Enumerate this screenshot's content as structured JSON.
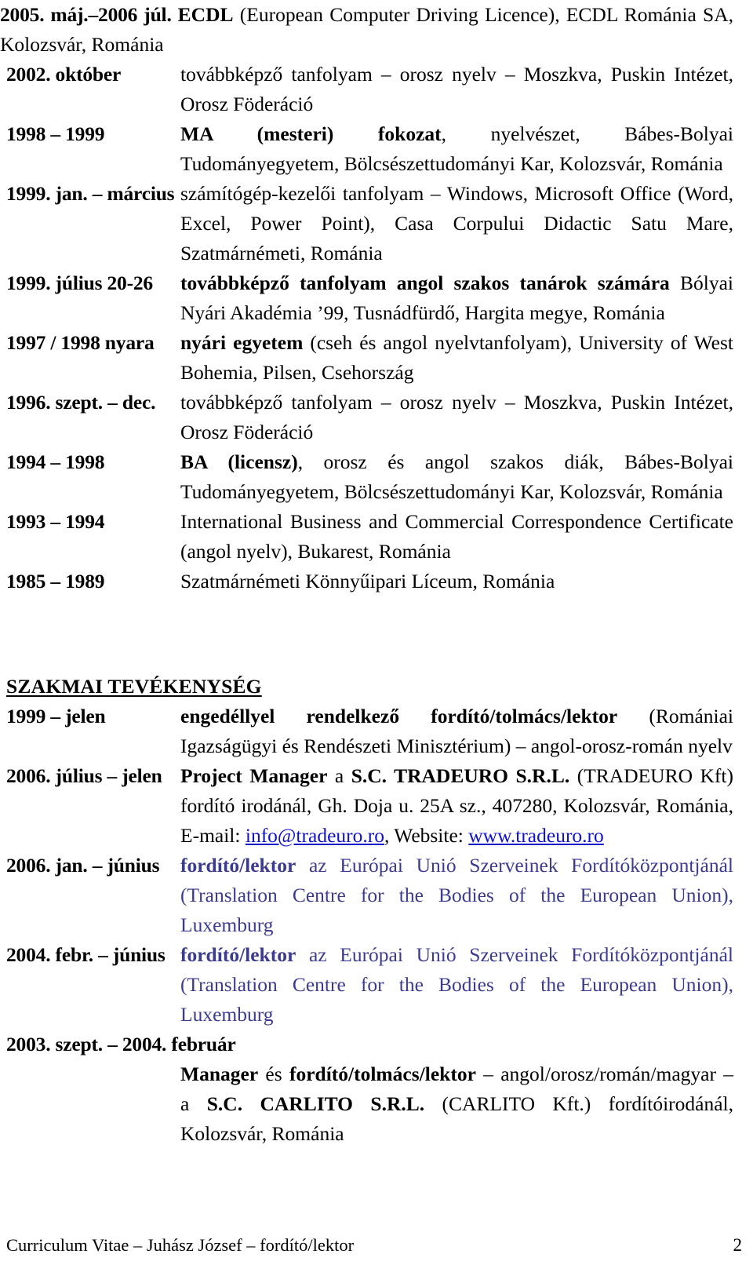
{
  "document": {
    "type": "curriculum-vitae",
    "language": "hu",
    "page_number": "2",
    "footer_text": "Curriculum Vitae – Juhász József – fordító/lektor",
    "link_color": "#1111cc",
    "eu_text_color": "#3b3b8f"
  },
  "education": {
    "entries": [
      {
        "label": "2005. máj.–2006 júl.",
        "inline": true,
        "segments": [
          {
            "text": "ECDL",
            "style": "bold"
          },
          {
            "text": " (European Computer Driving Licence), ECDL Románia SA, Kolozsvár, Románia",
            "style": "normal"
          }
        ]
      },
      {
        "label": "2002. október",
        "inline": false,
        "segments": [
          {
            "text": "továbbképző tanfolyam – orosz nyelv – Moszkva, Puskin Intézet, Orosz Föderáció",
            "style": "normal"
          }
        ]
      },
      {
        "label": "1998 – 1999",
        "inline": false,
        "segments": [
          {
            "text": "MA (mesteri) fokozat",
            "style": "bold"
          },
          {
            "text": ", nyelvészet, Bábes-Bolyai Tudományegyetem, Bölcsészettudományi Kar, Kolozsvár, Románia",
            "style": "normal"
          }
        ]
      },
      {
        "label": "1999. jan. – március",
        "inline": false,
        "segments": [
          {
            "text": "számítógép-kezelői tanfolyam – Windows, Microsoft Office (Word, Excel, Power Point), Casa Corpului Didactic Satu Mare, Szatmárnémeti, Románia",
            "style": "normal"
          }
        ]
      },
      {
        "label": "1999. július 20-26",
        "inline": false,
        "segments": [
          {
            "text": "továbbképző tanfolyam angol szakos tanárok számára",
            "style": "bold"
          },
          {
            "text": " Bólyai Nyári Akadémia ’99, Tusnádfürdő, Hargita megye, Románia",
            "style": "normal"
          }
        ]
      },
      {
        "label": "1997 / 1998 nyara",
        "inline": false,
        "segments": [
          {
            "text": "nyári egyetem",
            "style": "bold"
          },
          {
            "text": " (cseh és angol nyelvtanfolyam), University of West Bohemia, Pilsen, Csehország",
            "style": "normal"
          }
        ]
      },
      {
        "label": "1996. szept. – dec.",
        "inline": false,
        "segments": [
          {
            "text": "továbbképző tanfolyam – orosz nyelv – Moszkva, Puskin Intézet, Orosz Föderáció",
            "style": "normal"
          }
        ]
      },
      {
        "label": "1994 – 1998",
        "inline": false,
        "segments": [
          {
            "text": "BA (licensz)",
            "style": "bold"
          },
          {
            "text": ", orosz és angol szakos diák, Bábes-Bolyai Tudományegyetem, Bölcsészettudományi Kar, Kolozsvár, Románia",
            "style": "normal"
          }
        ]
      },
      {
        "label": "1993 – 1994",
        "inline": false,
        "segments": [
          {
            "text": "International Business and Commercial Correspondence Certificate (angol nyelv), Bukarest, Románia",
            "style": "normal"
          }
        ]
      },
      {
        "label": "1985 – 1989",
        "inline": false,
        "segments": [
          {
            "text": "Szatmárnémeti Könnyűipari Líceum, Románia",
            "style": "normal"
          }
        ]
      }
    ]
  },
  "experience": {
    "heading": "SZAKMAI  TEVÉKENYSÉG",
    "entries": [
      {
        "label": "1999 – jelen",
        "segments": [
          {
            "text": "engedéllyel rendelkező fordító/tolmács/lektor",
            "style": "bold"
          },
          {
            "text": " (Romániai Igazságügyi és Rendészeti Minisztérium) – angol-orosz-román nyelv",
            "style": "normal"
          }
        ]
      },
      {
        "label": "2006. július – jelen",
        "segments": [
          {
            "text": "Project Manager",
            "style": "bold"
          },
          {
            "text": " a ",
            "style": "normal"
          },
          {
            "text": "S.C. TRADEURO S.R.L.",
            "style": "bold"
          },
          {
            "text": " (TRADEURO Kft) fordító irodánál, Gh. Doja u. 25A sz., 407280, Kolozsvár, Románia, E-mail: ",
            "style": "normal"
          },
          {
            "text": "info@tradeuro.ro",
            "style": "link"
          },
          {
            "text": ", Website: ",
            "style": "normal"
          },
          {
            "text": "www.tradeuro.ro",
            "style": "link"
          }
        ]
      },
      {
        "label": "2006. jan. – június",
        "segments": [
          {
            "text": "fordító/lektor",
            "style": "bold-blue"
          },
          {
            "text": " az Európai Unió Szerveinek Fordítóközpontjánál (Translation Centre for the Bodies of the European Union), Luxemburg",
            "style": "blue"
          }
        ]
      },
      {
        "label": "2004. febr. – június",
        "segments": [
          {
            "text": "fordító/lektor",
            "style": "bold-blue"
          },
          {
            "text": " az Európai Unió Szerveinek Fordítóközpontjánál (Translation Centre for the Bodies of the European Union), Luxemburg",
            "style": "blue"
          }
        ]
      },
      {
        "label": "2003. szept. – 2004. február",
        "label_own_line": true,
        "segments": [
          {
            "text": "Manager",
            "style": "bold"
          },
          {
            "text": " és ",
            "style": "normal"
          },
          {
            "text": "fordító/tolmács/lektor",
            "style": "bold"
          },
          {
            "text": " – angol/orosz/román/magyar – a ",
            "style": "normal"
          },
          {
            "text": "S.C. CARLITO S.R.L.",
            "style": "bold"
          },
          {
            "text": " (CARLITO Kft.) fordítóirodánál, Kolozsvár, Románia",
            "style": "normal"
          }
        ]
      }
    ]
  }
}
